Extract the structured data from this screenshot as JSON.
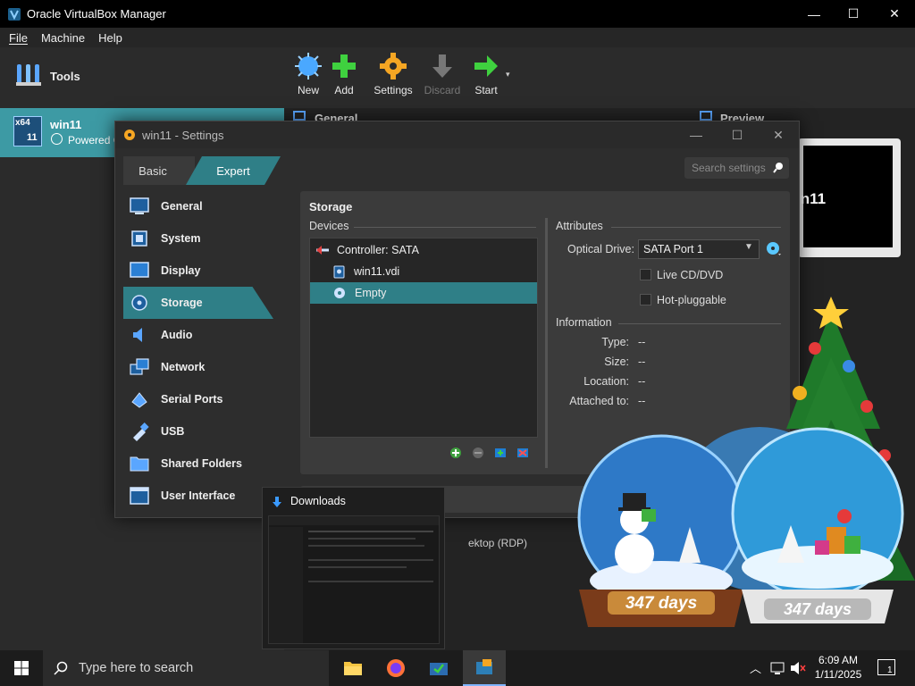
{
  "main_window": {
    "title": "Oracle VirtualBox Manager",
    "menu": [
      "File",
      "Machine",
      "Help"
    ],
    "controls": {
      "minimize": "—",
      "maximize": "☐",
      "close": "✕"
    }
  },
  "left_panel": {
    "tools_label": "Tools",
    "vm": {
      "name": "win11",
      "state": "Powered O",
      "os_badge": "x64",
      "os_version": "11"
    }
  },
  "toolbar": {
    "new": "New",
    "add": "Add",
    "settings": "Settings",
    "discard": "Discard",
    "start": "Start"
  },
  "details": {
    "general_header": "General",
    "preview_header": "Preview",
    "preview_text": "in11",
    "partial_text": "ektop (RDP)"
  },
  "settings_dialog": {
    "title": "win11 - Settings",
    "mode_tabs": {
      "basic": "Basic",
      "expert": "Expert"
    },
    "search_placeholder": "Search settings",
    "nav": [
      {
        "label": "General",
        "icon": "general-icon"
      },
      {
        "label": "System",
        "icon": "system-icon"
      },
      {
        "label": "Display",
        "icon": "display-icon"
      },
      {
        "label": "Storage",
        "icon": "storage-icon",
        "active": true
      },
      {
        "label": "Audio",
        "icon": "audio-icon"
      },
      {
        "label": "Network",
        "icon": "network-icon"
      },
      {
        "label": "Serial Ports",
        "icon": "serial-ports-icon"
      },
      {
        "label": "USB",
        "icon": "usb-icon"
      },
      {
        "label": "Shared Folders",
        "icon": "shared-folders-icon"
      },
      {
        "label": "User Interface",
        "icon": "user-interface-icon"
      }
    ],
    "storage": {
      "heading": "Storage",
      "devices_header": "Devices",
      "tree": {
        "controller": "Controller: SATA",
        "disk": "win11.vdi",
        "optical": "Empty"
      },
      "attributes_header": "Attributes",
      "optical_drive_label": "Optical Drive:",
      "optical_drive_value": "SATA Port 1",
      "live_cd_label": "Live CD/DVD",
      "hot_pluggable_label": "Hot-pluggable",
      "information_header": "Information",
      "info": [
        {
          "label": "Type:",
          "value": "--"
        },
        {
          "label": "Size:",
          "value": "--"
        },
        {
          "label": "Location:",
          "value": "--"
        },
        {
          "label": "Attached to:",
          "value": "--"
        }
      ]
    }
  },
  "thumbnail": {
    "title": "Downloads"
  },
  "taskbar": {
    "search_placeholder": "Type here to search",
    "time": "6:09 AM",
    "date": "1/11/2025",
    "notification_count": "1"
  },
  "widget": {
    "days_left_1": "347 days",
    "days_left_2": "347 days"
  },
  "colors": {
    "accent": "#2f7f87",
    "vm_selected": "#3d9aa4",
    "titlebar": "#000000"
  }
}
